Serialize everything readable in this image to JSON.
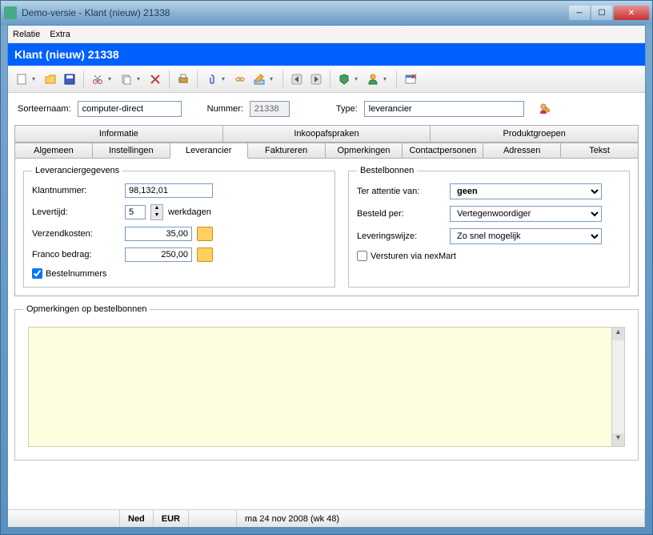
{
  "window": {
    "title": "Demo-versie - Klant (nieuw) 21338"
  },
  "menu": {
    "relatie": "Relatie",
    "extra": "Extra"
  },
  "header": {
    "title": "Klant (nieuw) 21338"
  },
  "form": {
    "sorteernaam_label": "Sorteernaam:",
    "sorteernaam_value": "computer-direct",
    "nummer_label": "Nummer:",
    "nummer_value": "21338",
    "type_label": "Type:",
    "type_value": "leverancier"
  },
  "tabs_top": {
    "informatie": "Informatie",
    "inkoopafspraken": "Inkoopafspraken",
    "produktgroepen": "Produktgroepen"
  },
  "tabs_sub": {
    "algemeen": "Algemeen",
    "instellingen": "Instellingen",
    "leverancier": "Leverancier",
    "faktureren": "Faktureren",
    "opmerkingen": "Opmerkingen",
    "contactpersonen": "Contactpersonen",
    "adressen": "Adressen",
    "tekst": "Tekst"
  },
  "leverancier": {
    "legend": "Leveranciergegevens",
    "klantnummer_label": "Klantnummer:",
    "klantnummer_value": "98,132,01",
    "levertijd_label": "Levertijd:",
    "levertijd_value": "5",
    "levertijd_unit": "werkdagen",
    "verzendkosten_label": "Verzendkosten:",
    "verzendkosten_value": "35,00",
    "franco_label": "Franco bedrag:",
    "franco_value": "250,00",
    "bestelnummers_label": "Bestelnummers"
  },
  "bestelbonnen": {
    "legend": "Bestelbonnen",
    "ter_attentie_label": "Ter attentie van:",
    "ter_attentie_value": "geen",
    "besteld_per_label": "Besteld per:",
    "besteld_per_value": "Vertegenwoordiger",
    "leveringswijze_label": "Leveringswijze:",
    "leveringswijze_value": "Zo snel mogelijk",
    "versturen_label": "Versturen via nexMart"
  },
  "comments": {
    "legend": "Opmerkingen op bestelbonnen"
  },
  "status": {
    "lang": "Ned",
    "cur": "EUR",
    "date": "ma 24 nov 2008 (wk 48)"
  }
}
